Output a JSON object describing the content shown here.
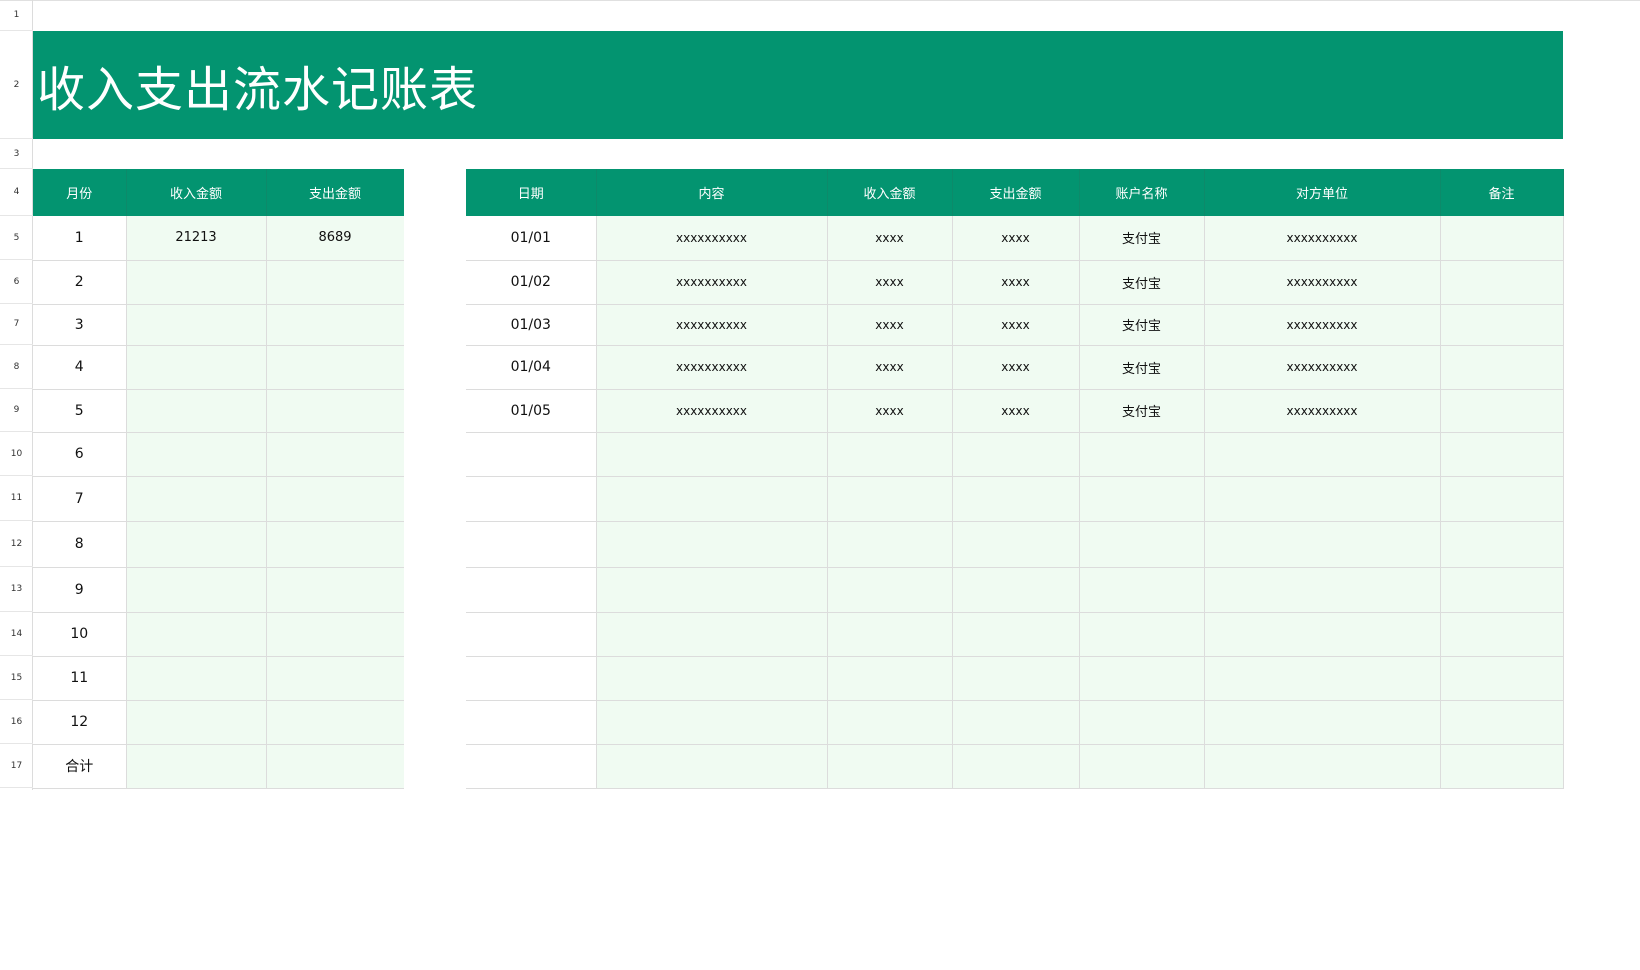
{
  "title": "收入支出流水记账表",
  "row_numbers": [
    "1",
    "2",
    "3",
    "4",
    "5",
    "6",
    "7",
    "8",
    "9",
    "10",
    "11",
    "12",
    "13",
    "14",
    "15",
    "16",
    "17"
  ],
  "summary": {
    "headers": [
      "月份",
      "收入金额",
      "支出金额"
    ],
    "rows": [
      [
        "1",
        "21213",
        "8689"
      ],
      [
        "2",
        "",
        ""
      ],
      [
        "3",
        "",
        ""
      ],
      [
        "4",
        "",
        ""
      ],
      [
        "5",
        "",
        ""
      ],
      [
        "6",
        "",
        ""
      ],
      [
        "7",
        "",
        ""
      ],
      [
        "8",
        "",
        ""
      ],
      [
        "9",
        "",
        ""
      ],
      [
        "10",
        "",
        ""
      ],
      [
        "11",
        "",
        ""
      ],
      [
        "12",
        "",
        ""
      ],
      [
        "合计",
        "",
        ""
      ]
    ]
  },
  "ledger": {
    "headers": [
      "日期",
      "内容",
      "收入金额",
      "支出金额",
      "账户名称",
      "对方单位",
      "备注"
    ],
    "rows": [
      [
        "01/01",
        "xxxxxxxxxx",
        "xxxx",
        "xxxx",
        "支付宝",
        "xxxxxxxxxx",
        ""
      ],
      [
        "01/02",
        "xxxxxxxxxx",
        "xxxx",
        "xxxx",
        "支付宝",
        "xxxxxxxxxx",
        ""
      ],
      [
        "01/03",
        "xxxxxxxxxx",
        "xxxx",
        "xxxx",
        "支付宝",
        "xxxxxxxxxx",
        ""
      ],
      [
        "01/04",
        "xxxxxxxxxx",
        "xxxx",
        "xxxx",
        "支付宝",
        "xxxxxxxxxx",
        ""
      ],
      [
        "01/05",
        "xxxxxxxxxx",
        "xxxx",
        "xxxx",
        "支付宝",
        "xxxxxxxxxx",
        ""
      ],
      [
        "",
        "",
        "",
        "",
        "",
        "",
        ""
      ],
      [
        "",
        "",
        "",
        "",
        "",
        "",
        ""
      ],
      [
        "",
        "",
        "",
        "",
        "",
        "",
        ""
      ],
      [
        "",
        "",
        "",
        "",
        "",
        "",
        ""
      ],
      [
        "",
        "",
        "",
        "",
        "",
        "",
        ""
      ],
      [
        "",
        "",
        "",
        "",
        "",
        "",
        ""
      ],
      [
        "",
        "",
        "",
        "",
        "",
        "",
        ""
      ],
      [
        "",
        "",
        "",
        "",
        "",
        "",
        ""
      ]
    ]
  },
  "colors": {
    "header_green": "#039470",
    "cell_light_green": "#f0fbf2",
    "grid_line": "#dcdcdc"
  }
}
